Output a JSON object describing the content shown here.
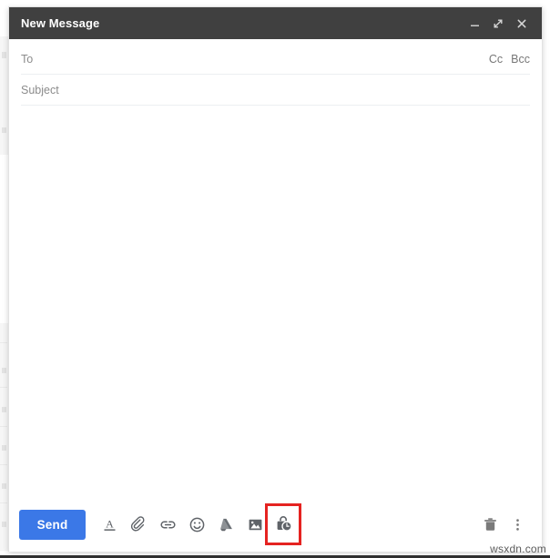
{
  "window": {
    "title": "New Message",
    "controls": [
      {
        "name": "minimize",
        "label": "Minimize",
        "glyph": "minimize-icon"
      },
      {
        "name": "expand",
        "label": "Full screen",
        "glyph": "expand-icon"
      },
      {
        "name": "close",
        "label": "Save & close",
        "glyph": "close-icon"
      }
    ]
  },
  "fields": {
    "to": {
      "label": "To",
      "placeholder": "To",
      "value": ""
    },
    "subject": {
      "label": "Subject",
      "placeholder": "Subject",
      "value": ""
    },
    "cc": "Cc",
    "bcc": "Bcc"
  },
  "body": {
    "placeholder": "",
    "value": ""
  },
  "footer": {
    "send_label": "Send",
    "tools": [
      {
        "id": "formatting",
        "name": "format-text-icon",
        "label": "Formatting options"
      },
      {
        "id": "attach",
        "name": "paperclip-icon",
        "label": "Attach files"
      },
      {
        "id": "link",
        "name": "link-icon",
        "label": "Insert link"
      },
      {
        "id": "emoji",
        "name": "emoji-icon",
        "label": "Insert emoji"
      },
      {
        "id": "drive",
        "name": "google-drive-icon",
        "label": "Insert files using Drive"
      },
      {
        "id": "photo",
        "name": "image-icon",
        "label": "Insert photo"
      },
      {
        "id": "confidential",
        "name": "lock-clock-icon",
        "label": "Toggle confidential mode",
        "highlighted": true
      }
    ],
    "right_tools": [
      {
        "id": "discard",
        "name": "trash-icon",
        "label": "Discard draft"
      },
      {
        "id": "more",
        "name": "more-options-icon",
        "label": "More options"
      }
    ]
  },
  "annotation": {
    "highlight_color": "#e52321"
  },
  "watermark": {
    "text": "wsxdn.com"
  },
  "colors": {
    "titlebar": "#404040",
    "send_button": "#3b78e7",
    "icon_gray": "#5f6368",
    "placeholder": "#8c8c8c"
  }
}
